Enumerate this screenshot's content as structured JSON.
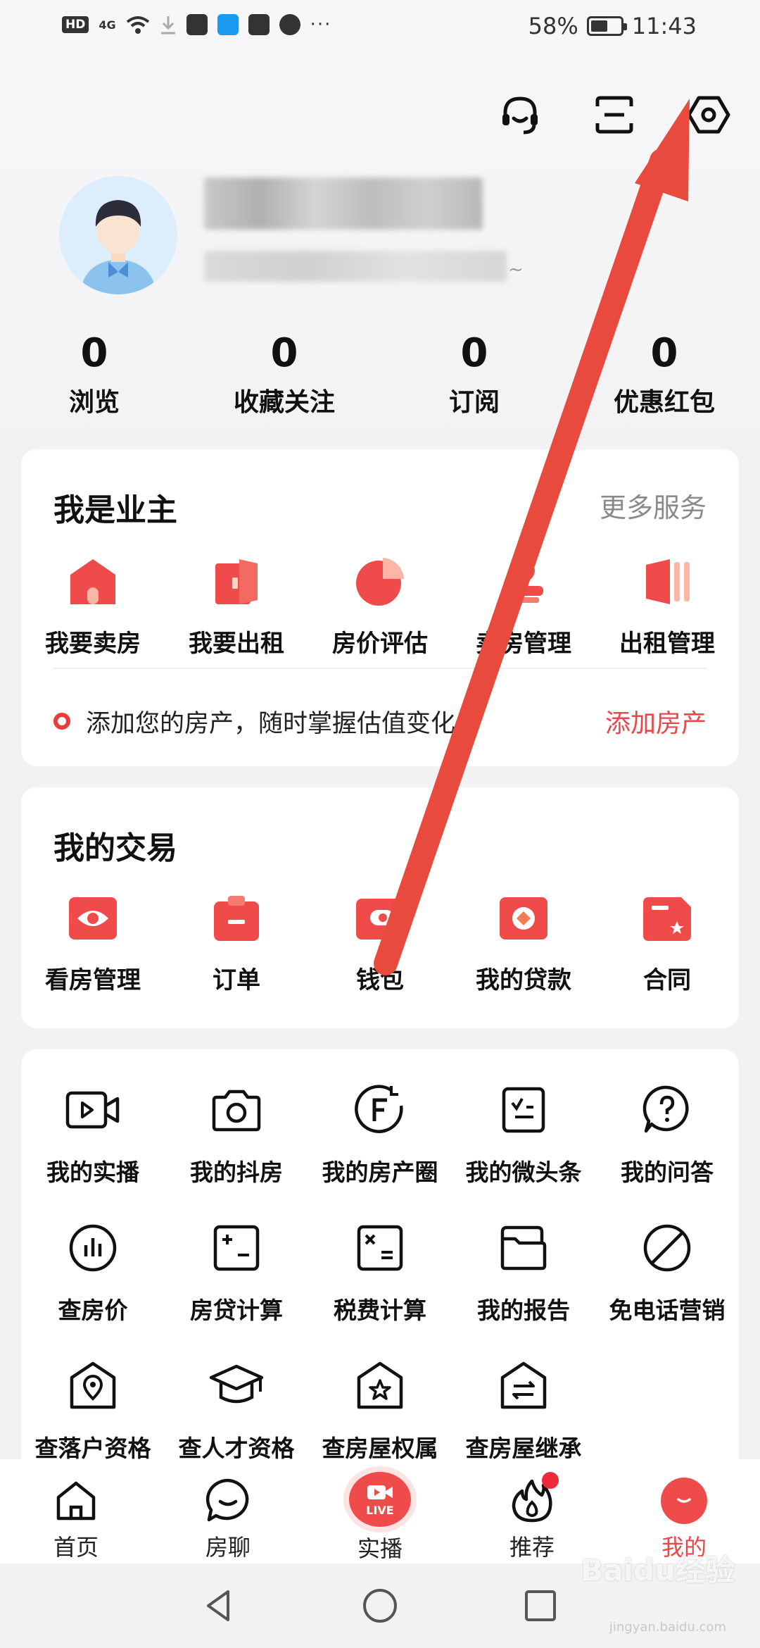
{
  "status_bar": {
    "hd": "HD",
    "signal": "4G",
    "battery": "58%",
    "battery_level": 0.58,
    "time": "11:43",
    "dots": "···"
  },
  "header_icons": [
    "headset-icon",
    "scan-icon",
    "settings-icon"
  ],
  "profile": {
    "name_hidden": true,
    "tilde": "~"
  },
  "stats": [
    {
      "value": "0",
      "label": "浏览"
    },
    {
      "value": "0",
      "label": "收藏关注"
    },
    {
      "value": "0",
      "label": "订阅"
    },
    {
      "value": "0",
      "label": "优惠红包"
    }
  ],
  "owner": {
    "title": "我是业主",
    "more": "更多服务",
    "items": [
      {
        "label": "我要卖房",
        "icon": "house-icon"
      },
      {
        "label": "我要出租",
        "icon": "door-icon"
      },
      {
        "label": "房价评估",
        "icon": "pie-chart-icon"
      },
      {
        "label": "卖房管理",
        "icon": "person-icon"
      },
      {
        "label": "出租管理",
        "icon": "panels-icon"
      }
    ],
    "tip": "添加您的房产，随时掌握估值变化",
    "tip_action": "添加房产"
  },
  "trade": {
    "title": "我的交易",
    "items": [
      {
        "label": "看房管理",
        "icon": "eye-icon"
      },
      {
        "label": "订单",
        "icon": "clipboard-icon"
      },
      {
        "label": "钱包",
        "icon": "wallet-icon"
      },
      {
        "label": "我的贷款",
        "icon": "loan-icon"
      },
      {
        "label": "合同",
        "icon": "contract-icon"
      }
    ]
  },
  "tools": [
    {
      "label": "我的实播",
      "icon": "video-icon"
    },
    {
      "label": "我的抖房",
      "icon": "camera-icon"
    },
    {
      "label": "我的房产圈",
      "icon": "f-circle-icon"
    },
    {
      "label": "我的微头条",
      "icon": "note-icon"
    },
    {
      "label": "我的问答",
      "icon": "question-icon"
    },
    {
      "label": "查房价",
      "icon": "bars-circle-icon"
    },
    {
      "label": "房贷计算",
      "icon": "calculator-icon"
    },
    {
      "label": "税费计算",
      "icon": "tax-calc-icon"
    },
    {
      "label": "我的报告",
      "icon": "folder-icon"
    },
    {
      "label": "免电话营销",
      "icon": "no-call-icon"
    },
    {
      "label": "查落户资格",
      "icon": "location-house-icon"
    },
    {
      "label": "查人才资格",
      "icon": "graduation-cap-icon"
    },
    {
      "label": "查房屋权属",
      "icon": "star-house-icon"
    },
    {
      "label": "查房屋继承",
      "icon": "transfer-house-icon"
    }
  ],
  "tabs": [
    {
      "label": "首页",
      "icon": "home-icon"
    },
    {
      "label": "房聊",
      "icon": "chat-icon"
    },
    {
      "label": "实播",
      "icon": "live-icon",
      "live": "LIVE"
    },
    {
      "label": "推荐",
      "icon": "flame-icon"
    },
    {
      "label": "我的",
      "icon": "me-icon",
      "active": true
    }
  ],
  "watermark": {
    "text": "Baidu经验",
    "sub": "jingyan.baidu.com"
  },
  "colors": {
    "accent": "#e8474b",
    "icon_red": "#ef4b4b",
    "arrow": "#e84a3d"
  }
}
